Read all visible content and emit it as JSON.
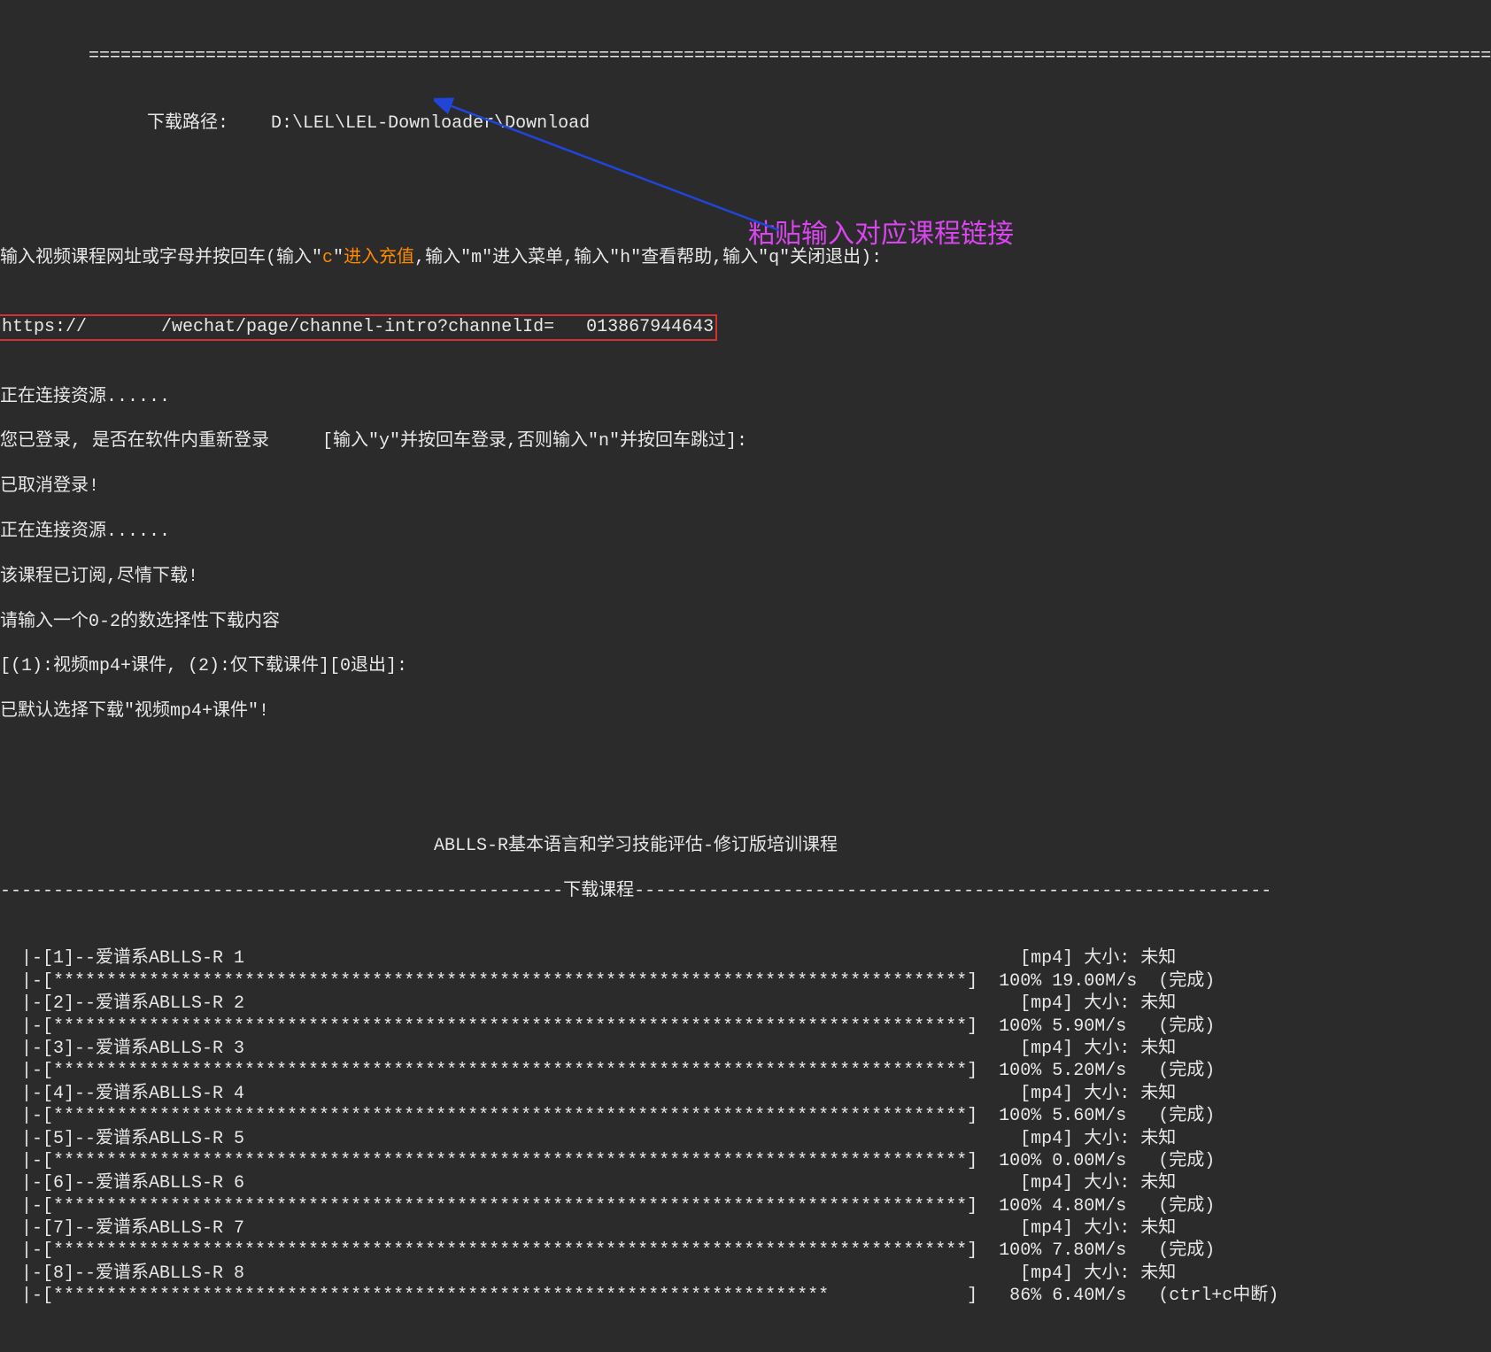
{
  "top_divider": "==========================================================================================================================================",
  "download_path_label": "下载路径:",
  "download_path_value": "D:\\LEL\\LEL-Downloader\\Download",
  "prompt_prefix": "输入视频课程网址或字母并按回车(输入",
  "prompt_c_quote_l": "\"",
  "prompt_c": "c",
  "prompt_c_quote_r": "\"",
  "prompt_c_action": "进入充值",
  "prompt_mid1": ",输入\"m\"进入菜单,输入\"h\"查看帮助,输入\"q\"关闭退出):",
  "url_input": "https://       /wechat/page/channel-intro?channelId=   013867944643",
  "connecting_1": "正在连接资源......",
  "login_prompt": "您已登录, 是否在软件内重新登录     [输入\"y\"并按回车登录,否则输入\"n\"并按回车跳过]:",
  "login_cancelled": "已取消登录!",
  "connecting_2": "正在连接资源......",
  "subscribed": "该课程已订阅,尽情下载!",
  "select_prompt": "请输入一个0-2的数选择性下载内容",
  "options_line": "[(1):视频mp4+课件, (2):仅下载课件][0退出]:",
  "default_selected": "已默认选择下载\"视频mp4+课件\"!",
  "course_title": "ABLLS-R基本语言和学习技能评估-修订版培训课程",
  "download_header": "-----------------------------------------------------下载课程------------------------------------------------------------",
  "annotation_text": "粘贴输入对应课程链接",
  "items": [
    {
      "idx": "1",
      "name": "--爱谱系ABLLS-R 1",
      "fmt": "[mp4]",
      "size": "大小: 未知",
      "pct": "100%",
      "speed": "19.00M/s",
      "status": "(完成)"
    },
    {
      "idx": "2",
      "name": "--爱谱系ABLLS-R 2",
      "fmt": "[mp4]",
      "size": "大小: 未知",
      "pct": "100%",
      "speed": "5.90M/s",
      "status": "(完成)"
    },
    {
      "idx": "3",
      "name": "--爱谱系ABLLS-R 3",
      "fmt": "[mp4]",
      "size": "大小: 未知",
      "pct": "100%",
      "speed": "5.20M/s",
      "status": "(完成)"
    },
    {
      "idx": "4",
      "name": "--爱谱系ABLLS-R 4",
      "fmt": "[mp4]",
      "size": "大小: 未知",
      "pct": "100%",
      "speed": "5.60M/s",
      "status": "(完成)"
    },
    {
      "idx": "5",
      "name": "--爱谱系ABLLS-R 5",
      "fmt": "[mp4]",
      "size": "大小: 未知",
      "pct": "100%",
      "speed": "0.00M/s",
      "status": "(完成)"
    },
    {
      "idx": "6",
      "name": "--爱谱系ABLLS-R 6",
      "fmt": "[mp4]",
      "size": "大小: 未知",
      "pct": "100%",
      "speed": "4.80M/s",
      "status": "(完成)"
    },
    {
      "idx": "7",
      "name": "--爱谱系ABLLS-R 7",
      "fmt": "[mp4]",
      "size": "大小: 未知",
      "pct": "100%",
      "speed": "7.80M/s",
      "status": "(完成)"
    },
    {
      "idx": "8",
      "name": "--爱谱系ABLLS-R 8",
      "fmt": "[mp4]",
      "size": "大小: 未知",
      "pct": "86%",
      "speed": "6.40M/s",
      "status": "(ctrl+c中断)"
    }
  ],
  "progress_bar_full": "[**************************************************************************************]",
  "progress_bar_86": "[*************************************************************************             ]"
}
